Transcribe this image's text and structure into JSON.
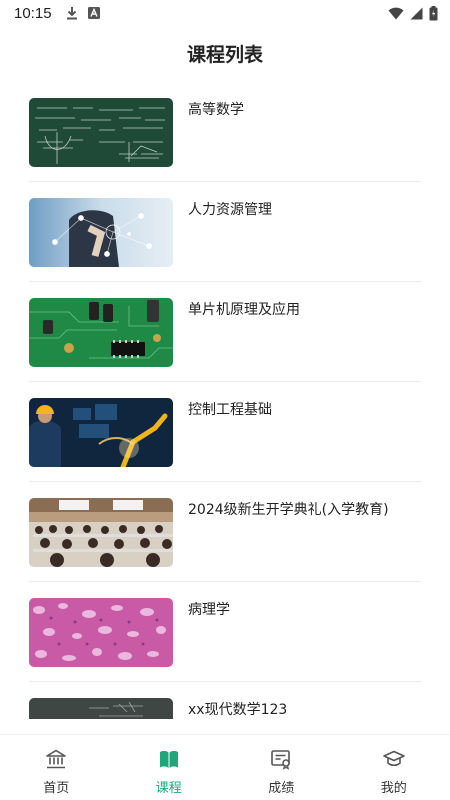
{
  "status_bar": {
    "time": "10:15"
  },
  "header": {
    "title": "课程列表"
  },
  "courses": [
    {
      "title": "高等数学",
      "thumb": "chalkboard-math-image"
    },
    {
      "title": "人力资源管理",
      "thumb": "business-network-image"
    },
    {
      "title": "单片机原理及应用",
      "thumb": "circuit-board-image"
    },
    {
      "title": "控制工程基础",
      "thumb": "robot-arm-engineer-image"
    },
    {
      "title": "2024级新生开学典礼(入学教育)",
      "thumb": "lecture-hall-image"
    },
    {
      "title": "病理学",
      "thumb": "tissue-micrograph-image"
    },
    {
      "title": "xx现代数学123",
      "thumb": "chalkboard-dark-image"
    }
  ],
  "tab_bar": {
    "tabs": [
      {
        "label": "首页",
        "icon": "bank-icon",
        "active": false
      },
      {
        "label": "课程",
        "icon": "book-icon",
        "active": true
      },
      {
        "label": "成绩",
        "icon": "grade-report-icon",
        "active": false
      },
      {
        "label": "我的",
        "icon": "graduation-cap-icon",
        "active": false
      }
    ]
  },
  "colors": {
    "accent": "#1fa67a",
    "text": "#222222",
    "divider": "#ececec"
  }
}
